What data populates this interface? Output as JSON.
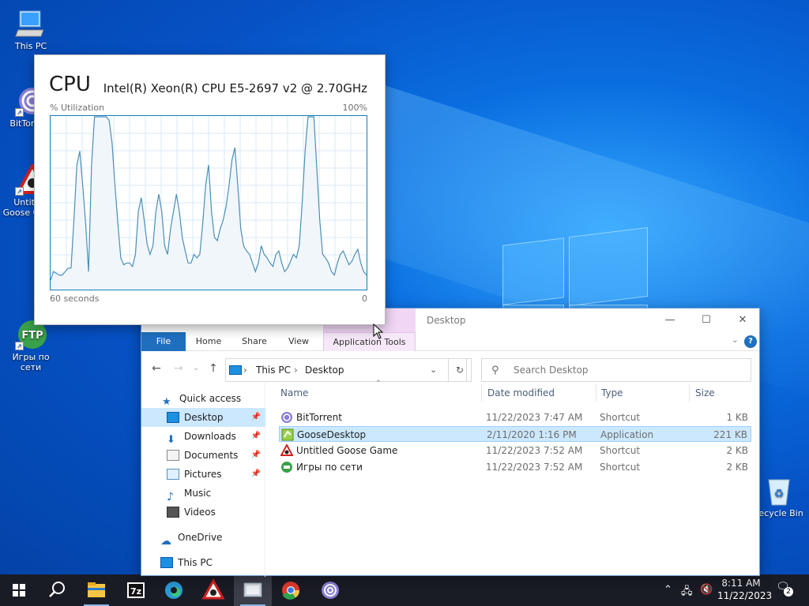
{
  "desktop": {
    "icons": [
      {
        "label": "This PC"
      },
      {
        "label": "BitTorrent"
      },
      {
        "label": "Untitled Goose Game"
      },
      {
        "label": "Игры по сети"
      },
      {
        "label": "Recycle Bin"
      }
    ]
  },
  "cpu": {
    "title": "CPU",
    "model": "Intel(R) Xeon(R) CPU E5-2697 v2 @ 2.70GHz",
    "util_label": "% Utilization",
    "max_label": "100%",
    "time_label": "60 seconds",
    "zero_label": "0",
    "series": [
      5,
      10,
      9,
      8,
      8,
      10,
      12,
      12,
      40,
      72,
      80,
      60,
      38,
      10,
      72,
      100,
      100,
      100,
      100,
      100,
      98,
      85,
      60,
      38,
      18,
      14,
      15,
      15,
      13,
      20,
      45,
      53,
      40,
      26,
      20,
      25,
      45,
      55,
      45,
      25,
      20,
      35,
      45,
      55,
      45,
      30,
      22,
      15,
      15,
      20,
      18,
      20,
      38,
      60,
      72,
      45,
      30,
      28,
      35,
      40,
      48,
      60,
      75,
      82,
      60,
      35,
      25,
      22,
      20,
      15,
      10,
      15,
      25,
      20,
      18,
      15,
      13,
      20,
      22,
      15,
      10,
      12,
      16,
      20,
      18,
      25,
      50,
      80,
      100,
      100,
      100,
      70,
      40,
      20,
      18,
      15,
      10,
      8,
      15,
      20,
      22,
      18,
      14,
      16,
      20,
      23,
      15,
      10,
      8
    ]
  },
  "explorer": {
    "title": "Desktop",
    "ribbon_tabs": {
      "file": "File",
      "home": "Home",
      "share": "Share",
      "view": "View",
      "app_tools": "Application Tools"
    },
    "address": {
      "root": "This PC",
      "current": "Desktop"
    },
    "search_placeholder": "Search Desktop",
    "nav": {
      "quick_access": "Quick access",
      "desktop": "Desktop",
      "downloads": "Downloads",
      "documents": "Documents",
      "pictures": "Pictures",
      "music": "Music",
      "videos": "Videos",
      "onedrive": "OneDrive",
      "this_pc": "This PC"
    },
    "columns": {
      "name": "Name",
      "date": "Date modified",
      "type": "Type",
      "size": "Size"
    },
    "files": [
      {
        "name": "BitTorrent",
        "date": "11/22/2023 7:47 AM",
        "type": "Shortcut",
        "size": "1 KB"
      },
      {
        "name": "GooseDesktop",
        "date": "2/11/2020 1:16 PM",
        "type": "Application",
        "size": "221 KB"
      },
      {
        "name": "Untitled Goose Game",
        "date": "11/22/2023 7:52 AM",
        "type": "Shortcut",
        "size": "2 KB"
      },
      {
        "name": "Игры по сети",
        "date": "11/22/2023 7:52 AM",
        "type": "Shortcut",
        "size": "2 KB"
      }
    ]
  },
  "taskbar": {
    "clock_time": "8:11 AM",
    "clock_date": "11/22/2023",
    "notification_count": "2",
    "apps": [
      "start-icon",
      "search-icon",
      "file-explorer-icon",
      "7zip-icon",
      "edge-icon",
      "goose-game-icon",
      "goose-desktop-icon",
      "chrome-icon",
      "bittorrent-icon"
    ]
  }
}
